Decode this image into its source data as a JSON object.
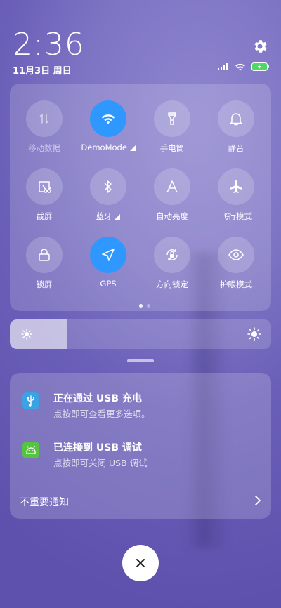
{
  "header": {
    "time": "2:36",
    "date": "11月3日 周日"
  },
  "colors": {
    "accent": "#2f98ff",
    "usb_icon": "#3aa3e3",
    "debug_icon": "#57c441"
  },
  "quick_settings": {
    "tiles": [
      {
        "label": "移动数据",
        "icon": "mobile-data-icon",
        "state": "disabled"
      },
      {
        "label": "DemoMode",
        "icon": "wifi-icon",
        "state": "active"
      },
      {
        "label": "手电筒",
        "icon": "flashlight-icon",
        "state": "off"
      },
      {
        "label": "静音",
        "icon": "bell-icon",
        "state": "off"
      },
      {
        "label": "截屏",
        "icon": "screenshot-icon",
        "state": "off"
      },
      {
        "label": "蓝牙",
        "icon": "bluetooth-icon",
        "state": "off"
      },
      {
        "label": "自动亮度",
        "icon": "auto-brightness-icon",
        "state": "off"
      },
      {
        "label": "飞行模式",
        "icon": "airplane-icon",
        "state": "off"
      },
      {
        "label": "锁屏",
        "icon": "lock-icon",
        "state": "off"
      },
      {
        "label": "GPS",
        "icon": "location-icon",
        "state": "active"
      },
      {
        "label": "方向锁定",
        "icon": "rotation-lock-icon",
        "state": "off"
      },
      {
        "label": "护眼模式",
        "icon": "eye-icon",
        "state": "off"
      }
    ],
    "page": 1,
    "page_count": 2
  },
  "brightness": {
    "level": 0.22
  },
  "notifications": {
    "items": [
      {
        "title": "正在通过 USB 充电",
        "subtitle": "点按即可查看更多选项。",
        "icon": "usb-icon"
      },
      {
        "title": "已连接到 USB 调试",
        "subtitle": "点按即可关闭 USB 调试",
        "icon": "android-debug-icon"
      }
    ],
    "unimportant_label": "不重要通知"
  }
}
